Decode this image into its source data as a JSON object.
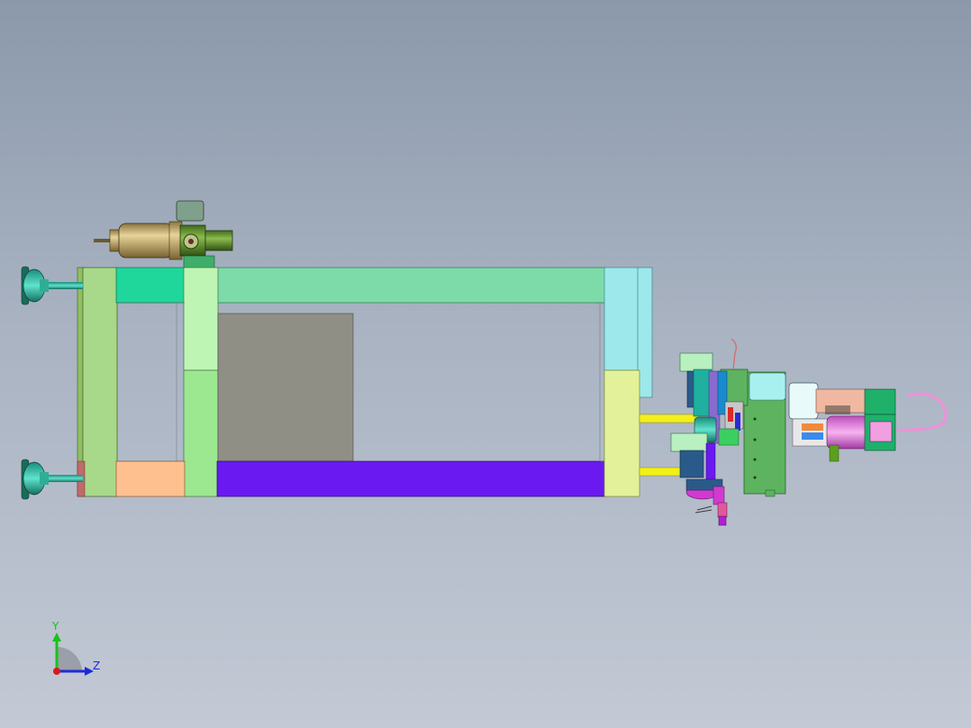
{
  "viewport": {
    "background_top": "#8b99ab",
    "background_bottom": "#c3c9d5"
  },
  "triad": {
    "y_label": "Y",
    "z_label": "Z",
    "y_color": "#17c417",
    "z_color": "#1d2bd6",
    "x_color": "#d81a1a"
  },
  "model": {
    "icons": [
      "cylinder-icon",
      "mold-frame-icon",
      "cylinder-rod-icon",
      "gripper-assembly-icon",
      "pink-hose-icon"
    ],
    "colors": {
      "frame_top_rail": "#7cdba8",
      "left_plate": "#a8d98a",
      "mid_plate": "#9be890",
      "cavity_panel": "#8f8f86",
      "bottom_rail": "#6a1af0",
      "right_plate": "#e3f29a",
      "right_cap": "#9de8ea",
      "guide_rod": "#f2ef1a",
      "cylinder_body": "#c9ad6a",
      "side_bracket": "#5db360"
    }
  }
}
